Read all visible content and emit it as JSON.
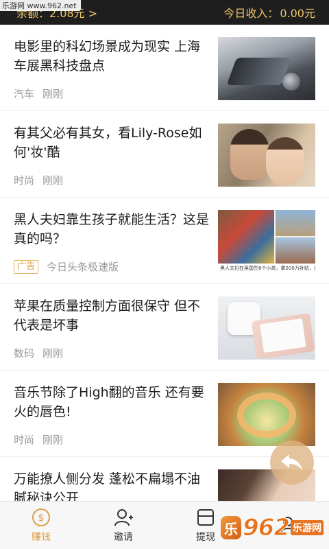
{
  "watermark_top": "乐游网 www.962.net",
  "balance_bar": {
    "balance_text": "余额：2.08元 >",
    "today_income_label": "今日收入：",
    "today_income_value": "0.00元"
  },
  "feed": [
    {
      "title": "电影里的科幻场景成为现实 上海车展黑科技盘点",
      "category": "汽车",
      "time": "刚刚",
      "thumb": "car-interior"
    },
    {
      "title": "有其父必有其女，看Lily-Rose如何'妆'酷",
      "category": "时尚",
      "time": "刚刚",
      "thumb": "celebrity-photo"
    },
    {
      "title": "黑人夫妇靠生孩子就能生活？这是真的吗？",
      "ad_tag": "广告",
      "source": "今日头条极速版",
      "thumb": "family-collage",
      "thumb_caption": "黑人夫妇在英国生8个小孩，拿200万补贴，还换免费房子!"
    },
    {
      "title": "苹果在质量控制方面很保守 但不代表是坏事",
      "category": "数码",
      "time": "刚刚",
      "thumb": "airpods-phone"
    },
    {
      "title": "音乐节除了High翻的音乐 还有要火的唇色!",
      "category": "时尚",
      "time": "刚刚",
      "thumb": "festival-group"
    },
    {
      "title": "万能撩人侧分发 蓬松不扁塌不油腻秘诀公开",
      "thumb": "woman-portrait"
    }
  ],
  "tabs": [
    {
      "label": "赚钱",
      "icon": "coin-icon",
      "active": true
    },
    {
      "label": "邀请",
      "icon": "add-user-icon",
      "active": false
    },
    {
      "label": "提现",
      "icon": "card-icon",
      "active": false
    },
    {
      "label": "",
      "icon": "profile-icon",
      "active": false
    }
  ],
  "watermark_bottom": {
    "number": "962",
    "site": "乐游网"
  },
  "colors": {
    "accent": "#d9a04a",
    "topbar_bg": "#1e1e1e",
    "topbar_text": "#f1c76a",
    "ad_tag": "#e0a250"
  }
}
